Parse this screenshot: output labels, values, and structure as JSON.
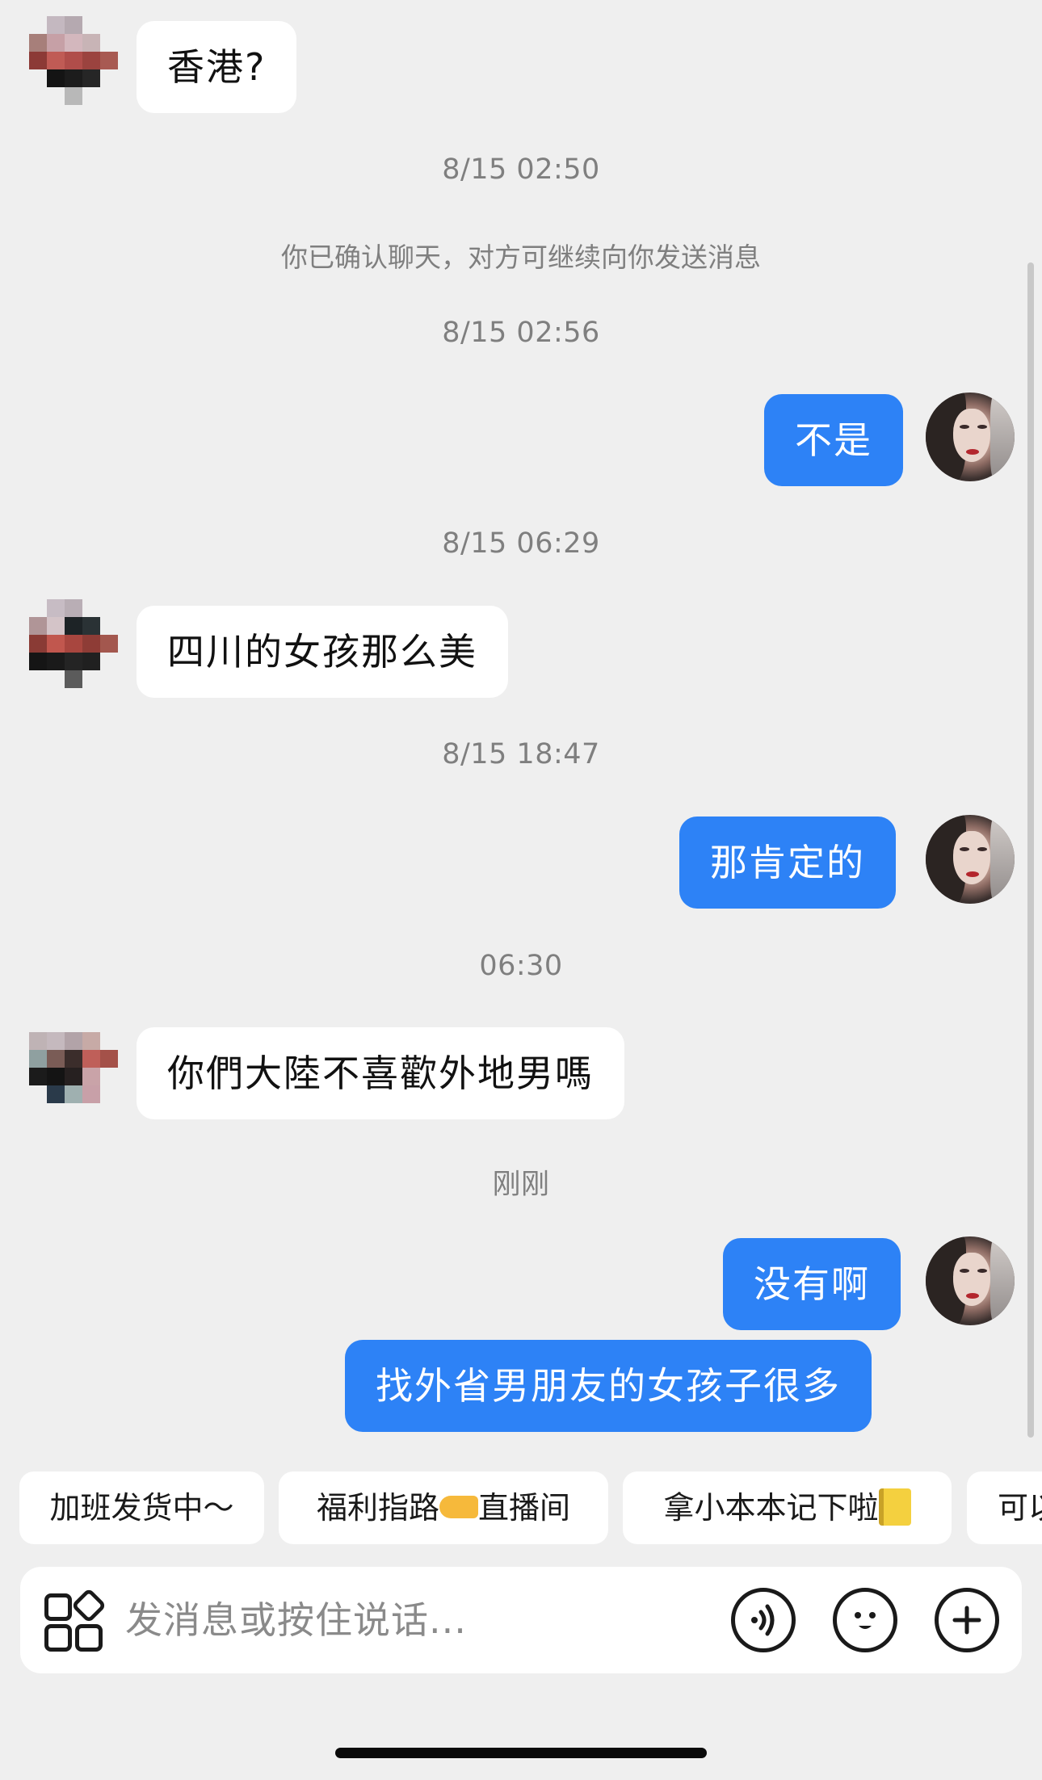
{
  "messages": [
    {
      "side": "in",
      "text": "香港?"
    },
    {
      "type": "timestamp",
      "text": "8/15 02:50"
    },
    {
      "type": "system",
      "text": "你已确认聊天，对方可继续向你发送消息"
    },
    {
      "type": "timestamp",
      "text": "8/15 02:56"
    },
    {
      "side": "out",
      "text": "不是"
    },
    {
      "type": "timestamp",
      "text": "8/15 06:29"
    },
    {
      "side": "in",
      "text": "四川的女孩那么美"
    },
    {
      "type": "timestamp",
      "text": "8/15 18:47"
    },
    {
      "side": "out",
      "text": "那肯定的"
    },
    {
      "type": "timestamp",
      "text": "06:30"
    },
    {
      "side": "in",
      "text": "你們大陸不喜歡外地男嗎"
    },
    {
      "type": "timestamp",
      "text": "刚刚"
    },
    {
      "side": "out",
      "text": "没有啊"
    },
    {
      "side": "out",
      "text": "找外省男朋友的女孩子很多"
    }
  ],
  "quick_replies": [
    {
      "text": "加班发货中～"
    },
    {
      "text": "福利指路",
      "emoji": "point-right-emoji",
      "suffix": "直播间"
    },
    {
      "text": "拿小本本记下啦",
      "emoji": "notebook-emoji"
    },
    {
      "text": "可以"
    }
  ],
  "input": {
    "placeholder": "发消息或按住说话..."
  },
  "colors": {
    "background": "#efefef",
    "outgoing_bubble": "#2d82f6",
    "incoming_bubble": "#ffffff",
    "timestamp_text": "#7f7f7f"
  },
  "icons": {
    "apps": "apps-grid-icon",
    "voice": "voice-wave-icon",
    "emoji": "smiley-icon",
    "plus": "plus-icon"
  }
}
